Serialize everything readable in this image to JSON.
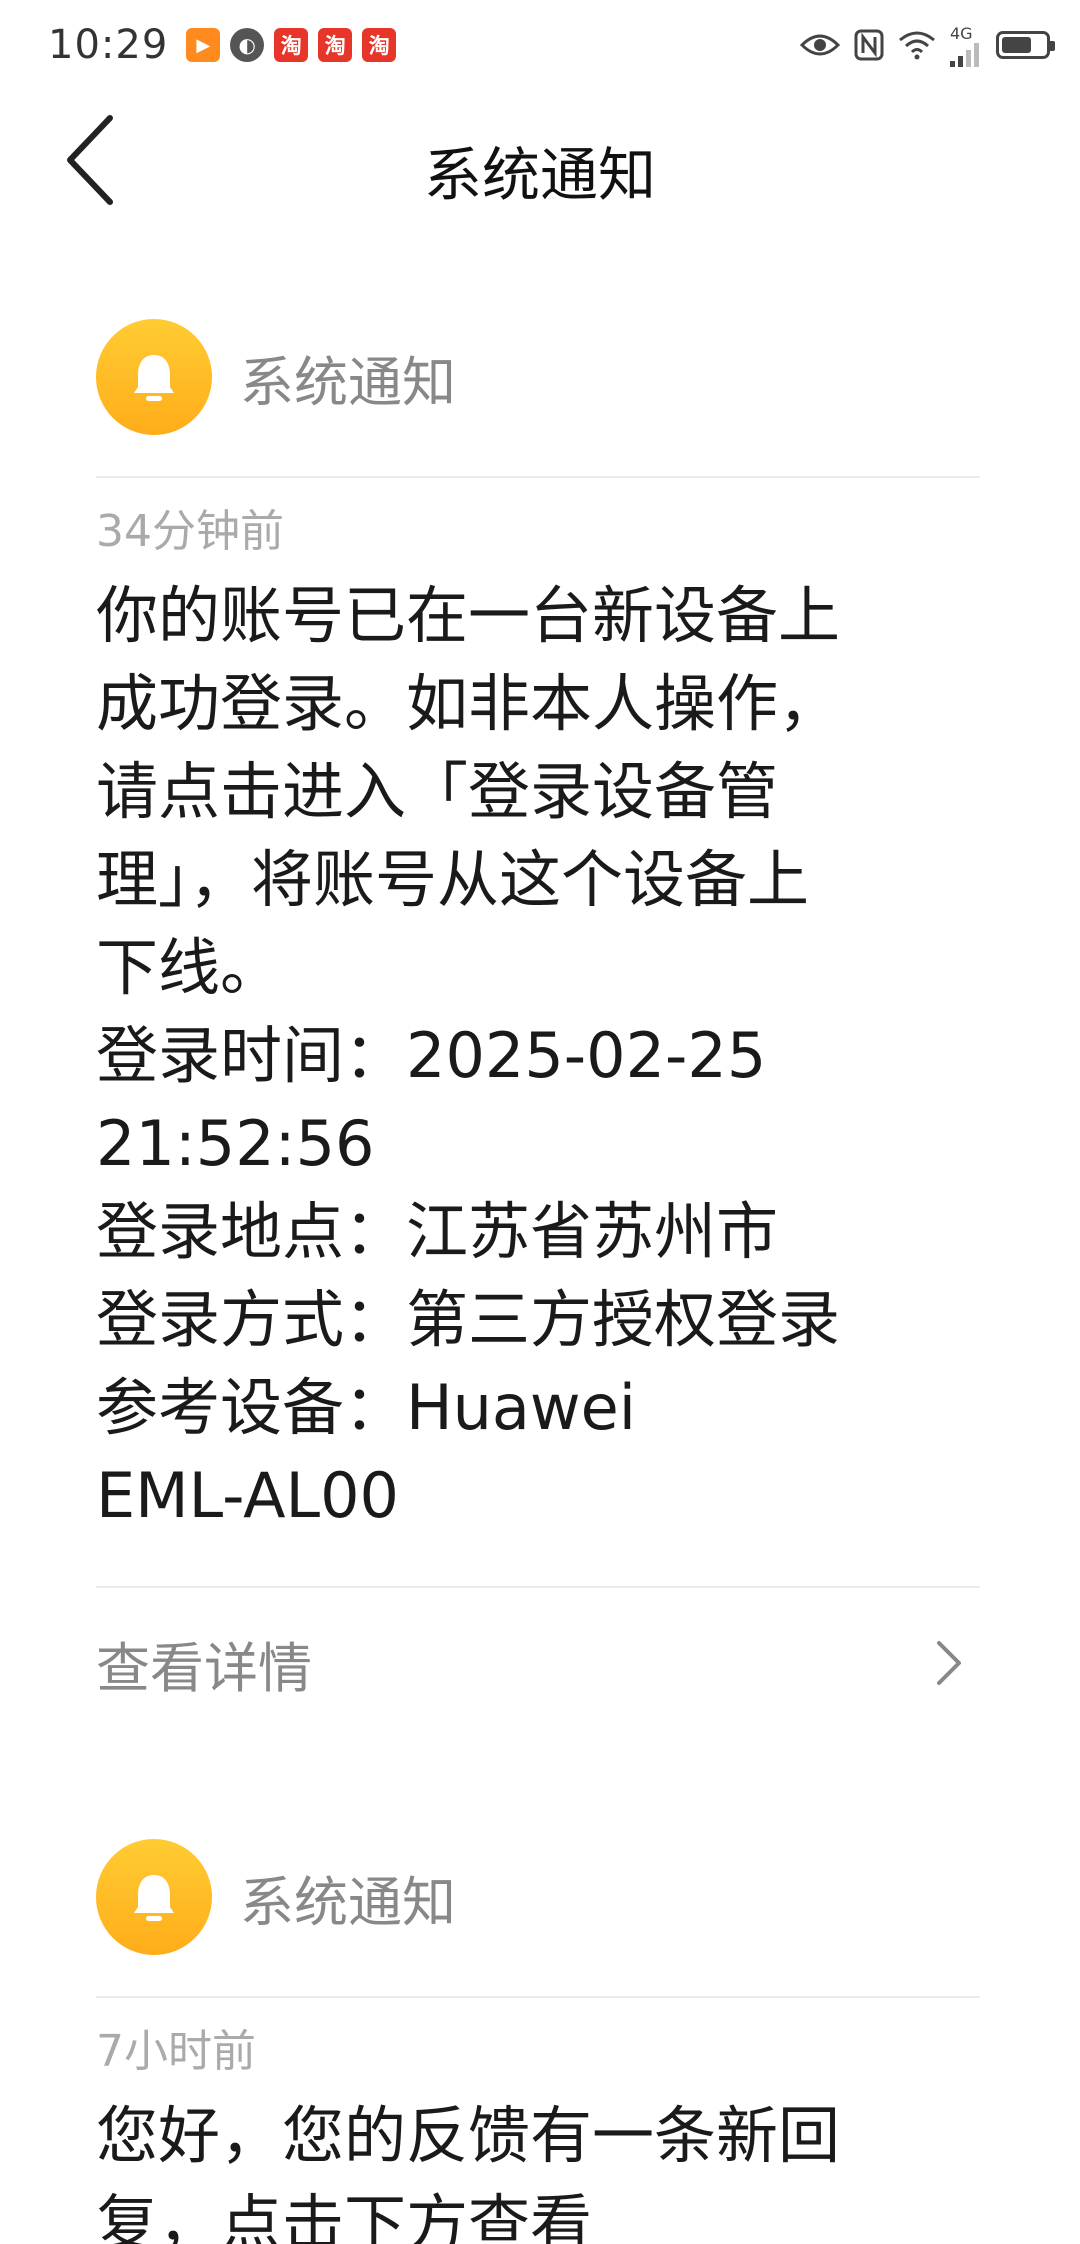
{
  "status_bar": {
    "time": "10:29",
    "badge_tao": "淘",
    "network_type": "4G",
    "battery_percent": 70
  },
  "header": {
    "title": "系统通知"
  },
  "notifications": [
    {
      "sender": "系统通知",
      "time": "34分钟前",
      "body_lines": [
        "你的账号已在一台新设备上",
        "成功登录。如非本人操作，",
        "请点击进入「登录设备管",
        "理」，将账号从这个设备上",
        "下线。",
        "登录时间：2025-02-25",
        "21:52:56",
        "登录地点：江苏省苏州市",
        "登录方式：第三方授权登录",
        "参考设备：Huawei",
        "EML-AL00"
      ],
      "detail_label": "查看详情"
    },
    {
      "sender": "系统通知",
      "time": "7小时前",
      "body_lines": [
        "您好，您的反馈有一条新回",
        "复，点击下方查看"
      ]
    }
  ],
  "colors": {
    "accent": "#ffb31f",
    "secondary_text": "#888888",
    "timestamp_text": "#aaaaaa"
  }
}
